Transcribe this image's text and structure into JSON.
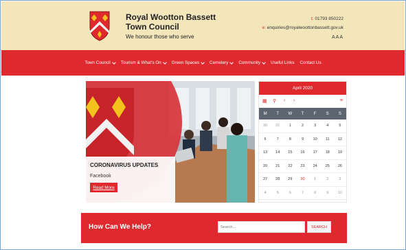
{
  "header": {
    "title_line1": "Royal Wootton Bassett",
    "title_line2": "Town Council",
    "tagline": "We honour those who serve",
    "phone_label": "t:",
    "phone": "01793 850222",
    "email_label": "e:",
    "email": "enquiries@royalwoottonbassett.gov.uk",
    "accessibility": "AAA"
  },
  "nav": {
    "items": [
      {
        "label": "Town Council",
        "dropdown": true
      },
      {
        "label": "Tourism & What's On",
        "dropdown": true
      },
      {
        "label": "Green Spaces",
        "dropdown": true
      },
      {
        "label": "Cemetery",
        "dropdown": true
      },
      {
        "label": "Community",
        "dropdown": true
      },
      {
        "label": "Useful Links",
        "dropdown": false
      },
      {
        "label": "Contact Us",
        "dropdown": false
      }
    ]
  },
  "hero": {
    "title": "CORONAVIRUS UPDATES",
    "link": "Facebook",
    "button": "Read More"
  },
  "calendar": {
    "month": "April 2020",
    "tools": {
      "prev": "‹",
      "next": "›"
    },
    "weekdays": [
      "M",
      "T",
      "W",
      "T",
      "F",
      "S",
      "S"
    ],
    "weeks": [
      [
        "30",
        "31",
        "1",
        "2",
        "3",
        "4",
        "5"
      ],
      [
        "6",
        "7",
        "8",
        "9",
        "10",
        "11",
        "12"
      ],
      [
        "13",
        "14",
        "15",
        "16",
        "17",
        "18",
        "19"
      ],
      [
        "20",
        "21",
        "22",
        "23",
        "24",
        "25",
        "26"
      ],
      [
        "27",
        "28",
        "29",
        "30",
        "1",
        "2",
        "3"
      ],
      [
        "4",
        "5",
        "6",
        "7",
        "8",
        "9",
        "10"
      ]
    ],
    "highlight": "30"
  },
  "help": {
    "title": "How Can We Help?",
    "search_placeholder": "Search...",
    "search_button": "SEARCH"
  },
  "colors": {
    "brand_red": "#e0292f",
    "header_bg": "#f3e6bb",
    "calendar_dark": "#5d6670"
  }
}
